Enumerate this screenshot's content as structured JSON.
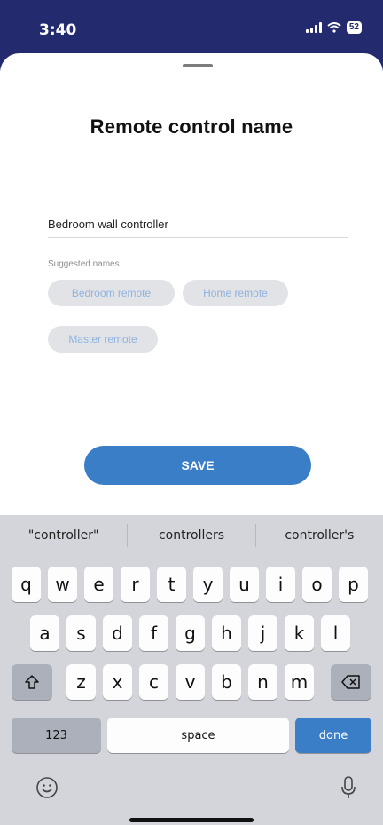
{
  "status_bar": {
    "time": "3:40",
    "battery": "52"
  },
  "sheet": {
    "title": "Remote control name",
    "name_value": "Bedroom wall controller",
    "suggested_label": "Suggested names",
    "suggestions": [
      "Bedroom remote",
      "Home remote",
      "Master remote"
    ],
    "save_label": "SAVE"
  },
  "colors": {
    "status_bar": "#232a6e",
    "accent": "#3b7ec8",
    "chip_bg": "#e2e3e6",
    "chip_text": "#8eb3df"
  },
  "keyboard": {
    "predictions": [
      "\"controller\"",
      "controllers",
      "controller's"
    ],
    "row1": [
      "q",
      "w",
      "e",
      "r",
      "t",
      "y",
      "u",
      "i",
      "o",
      "p"
    ],
    "row2": [
      "a",
      "s",
      "d",
      "f",
      "g",
      "h",
      "j",
      "k",
      "l"
    ],
    "row3": [
      "z",
      "x",
      "c",
      "v",
      "b",
      "n",
      "m"
    ],
    "numbers_label": "123",
    "space_label": "space",
    "done_label": "done"
  }
}
